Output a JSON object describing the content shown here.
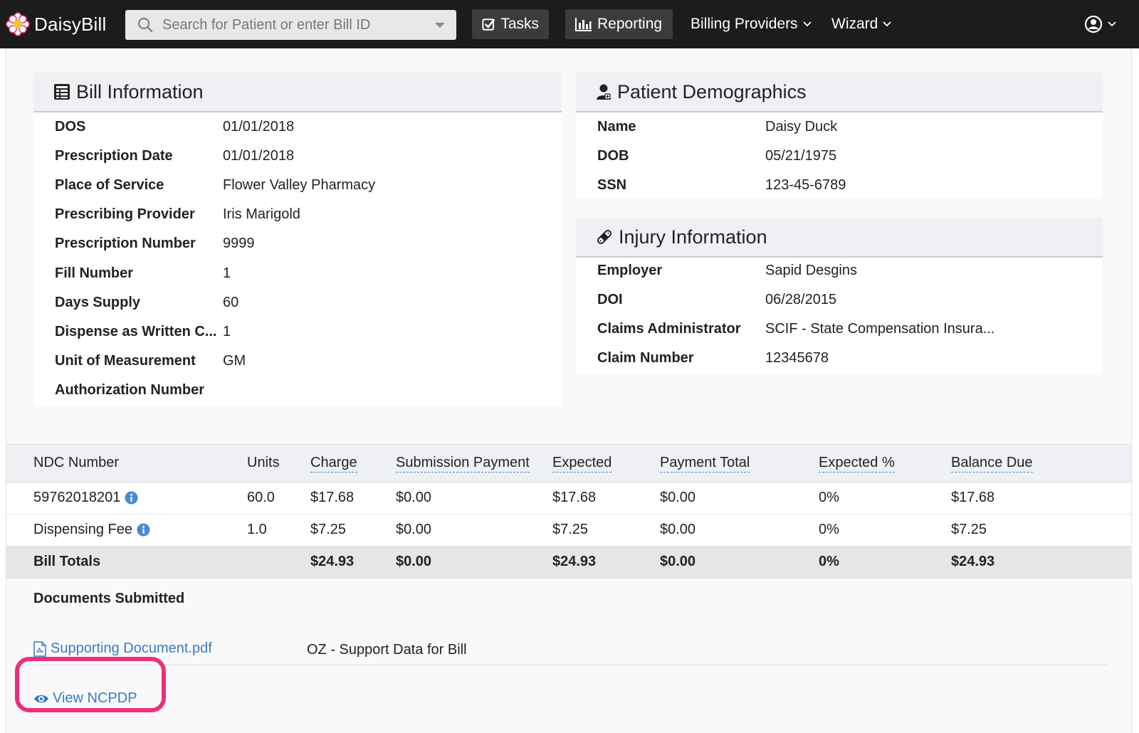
{
  "navbar": {
    "brand": "DaisyBill",
    "search_placeholder": "Search for Patient or enter Bill ID",
    "tasks_label": "Tasks",
    "reporting_label": "Reporting",
    "billing_providers_label": "Billing Providers",
    "wizard_label": "Wizard"
  },
  "bill_information": {
    "title": "Bill Information",
    "fields": [
      {
        "label": "DOS",
        "value": "01/01/2018"
      },
      {
        "label": "Prescription Date",
        "value": "01/01/2018"
      },
      {
        "label": "Place of Service",
        "value": "Flower Valley Pharmacy"
      },
      {
        "label": "Prescribing Provider",
        "value": "Iris Marigold"
      },
      {
        "label": "Prescription Number",
        "value": "9999"
      },
      {
        "label": "Fill Number",
        "value": "1"
      },
      {
        "label": "Days Supply",
        "value": "60"
      },
      {
        "label": "Dispense as Written C...",
        "value": "1"
      },
      {
        "label": "Unit of Measurement",
        "value": "GM"
      },
      {
        "label": "Authorization Number",
        "value": ""
      }
    ]
  },
  "patient_demographics": {
    "title": "Patient Demographics",
    "fields": [
      {
        "label": "Name",
        "value": "Daisy Duck"
      },
      {
        "label": "DOB",
        "value": "05/21/1975"
      },
      {
        "label": "SSN",
        "value": "123-45-6789"
      }
    ]
  },
  "injury_information": {
    "title": "Injury Information",
    "fields": [
      {
        "label": "Employer",
        "value": "Sapid Desgins"
      },
      {
        "label": "DOI",
        "value": "06/28/2015"
      },
      {
        "label": "Claims Administrator",
        "value": "SCIF - State Compensation Insura..."
      },
      {
        "label": "Claim Number",
        "value": "12345678"
      }
    ]
  },
  "line_items": {
    "headers": {
      "ndc": "NDC Number",
      "units": "Units",
      "charge": "Charge",
      "submission_payment": "Submission Payment",
      "expected": "Expected",
      "payment_total": "Payment Total",
      "expected_pct": "Expected %",
      "balance_due": "Balance Due"
    },
    "rows": [
      {
        "ndc": "59762018201",
        "units": "60.0",
        "charge": "$17.68",
        "submission_payment": "$0.00",
        "expected": "$17.68",
        "payment_total": "$0.00",
        "expected_pct": "0%",
        "balance_due": "$17.68"
      },
      {
        "ndc": "Dispensing Fee",
        "units": "1.0",
        "charge": "$7.25",
        "submission_payment": "$0.00",
        "expected": "$7.25",
        "payment_total": "$0.00",
        "expected_pct": "0%",
        "balance_due": "$7.25"
      }
    ],
    "totals": {
      "label": "Bill Totals",
      "charge": "$24.93",
      "submission_payment": "$0.00",
      "expected": "$24.93",
      "payment_total": "$0.00",
      "expected_pct": "0%",
      "balance_due": "$24.93"
    }
  },
  "documents": {
    "title": "Documents Submitted",
    "items": [
      {
        "file": "Supporting Document.pdf",
        "description": "OZ - Support Data for Bill"
      }
    ],
    "view_ncpdp_label": "View NCPDP"
  },
  "colors": {
    "navbar_bg": "#1c1c1c",
    "link": "#3a7ac8",
    "highlight": "#ee2f7a",
    "panel_header": "#eef0f4"
  }
}
